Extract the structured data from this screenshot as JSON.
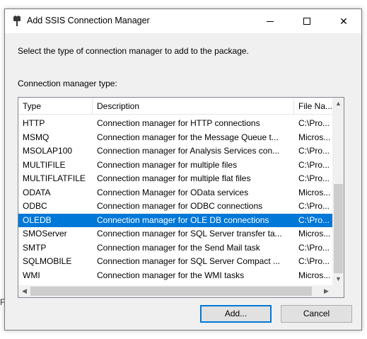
{
  "window": {
    "title": "Add SSIS Connection Manager",
    "icon": "plug-icon",
    "close_glyph": "✕"
  },
  "instruction": "Select the type of connection manager to add to the package.",
  "list_label": "Connection manager type:",
  "columns": [
    "Type",
    "Description",
    "File Na..."
  ],
  "rows": [
    {
      "type": "HTTP",
      "description": "Connection manager for HTTP connections",
      "file": "C:\\Pro..."
    },
    {
      "type": "MSMQ",
      "description": "Connection manager for the Message Queue t...",
      "file": "Micros..."
    },
    {
      "type": "MSOLAP100",
      "description": "Connection manager for Analysis Services con...",
      "file": "C:\\Pro..."
    },
    {
      "type": "MULTIFILE",
      "description": "Connection manager for multiple files",
      "file": "C:\\Pro..."
    },
    {
      "type": "MULTIFLATFILE",
      "description": "Connection manager for multiple flat files",
      "file": "C:\\Pro..."
    },
    {
      "type": "ODATA",
      "description": "Connection Manager for OData services",
      "file": "Micros..."
    },
    {
      "type": "ODBC",
      "description": "Connection manager for ODBC connections",
      "file": "C:\\Pro..."
    },
    {
      "type": "OLEDB",
      "description": "Connection manager for OLE DB connections",
      "file": "C:\\Pro..."
    },
    {
      "type": "SMOServer",
      "description": "Connection manager for SQL Server transfer ta...",
      "file": "Micros..."
    },
    {
      "type": "SMTP",
      "description": "Connection manager for the Send Mail task",
      "file": "C:\\Pro..."
    },
    {
      "type": "SQLMOBILE",
      "description": "Connection manager for SQL Server Compact ...",
      "file": "C:\\Pro..."
    },
    {
      "type": "WMI",
      "description": "Connection manager for the WMI tasks",
      "file": "Micros..."
    }
  ],
  "selected_type": "OLEDB",
  "buttons": {
    "add": "Add...",
    "cancel": "Cancel"
  },
  "background_fragment": "F",
  "colors": {
    "selection": "#0078d7",
    "dialog_bg": "#f0f0f0"
  }
}
